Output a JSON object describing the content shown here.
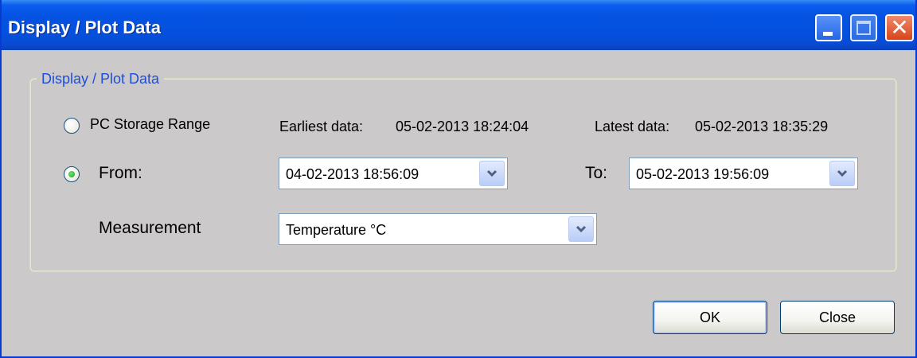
{
  "window": {
    "title": "Display / Plot Data"
  },
  "group": {
    "legend": "Display / Plot Data"
  },
  "range_options": {
    "pc_storage_label": "PC Storage Range",
    "pc_storage_selected": false,
    "from_label": "From:",
    "from_selected": true,
    "to_label": "To:"
  },
  "info": {
    "earliest_label": "Earliest data:",
    "earliest_value": "05-02-2013 18:24:04",
    "latest_label": "Latest data:",
    "latest_value": "05-02-2013 18:35:29"
  },
  "from_combo": {
    "value": "04-02-2013 18:56:09"
  },
  "to_combo": {
    "value": "05-02-2013 19:56:09"
  },
  "measurement": {
    "label": "Measurement",
    "value": "Temperature °C"
  },
  "buttons": {
    "ok": "OK",
    "close": "Close"
  },
  "colors": {
    "titlebar": "#0553e2",
    "legend_text": "#1e4fd8",
    "dialog_bg": "#cbc9ca"
  },
  "icons": {
    "minimize": "minimize-icon",
    "maximize": "maximize-icon",
    "close": "close-icon",
    "dropdown": "chevron-down-icon"
  }
}
